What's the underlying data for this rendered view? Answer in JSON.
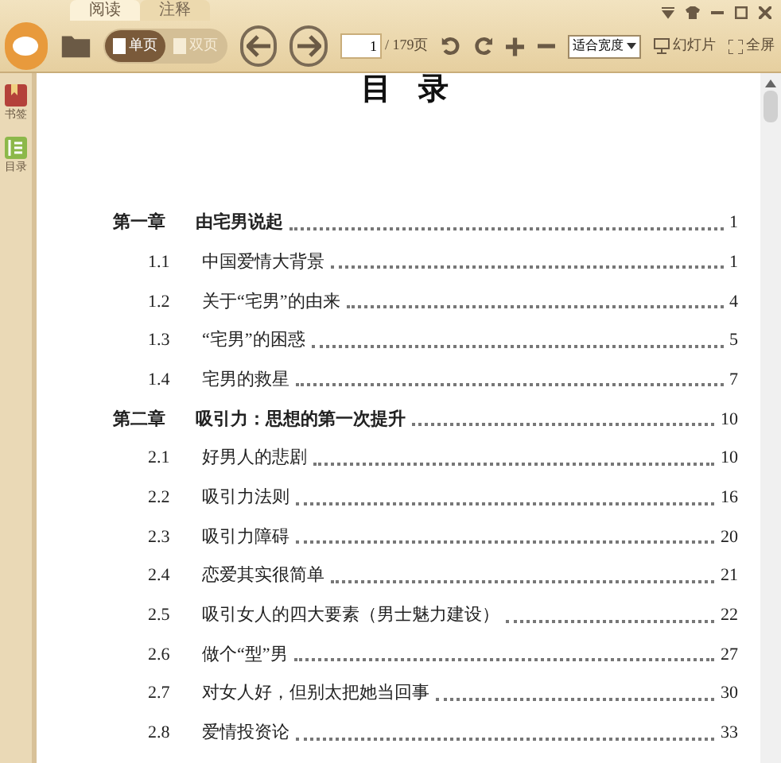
{
  "tabs": [
    {
      "label": "阅读",
      "selected": true
    },
    {
      "label": "注释",
      "selected": false
    }
  ],
  "toolbar": {
    "view_modes": [
      {
        "label": "单页",
        "selected": true
      },
      {
        "label": "双页",
        "selected": false
      }
    ],
    "page_input": "1",
    "page_total": "/ 179页",
    "zoom_select": "适合宽度",
    "slideshow": "幻灯片",
    "fullscreen": "全屏"
  },
  "sidebar": {
    "items": [
      {
        "label": "书签",
        "kind": "bookmark"
      },
      {
        "label": "目录",
        "kind": "toc"
      }
    ]
  },
  "toc": {
    "title": "目 录",
    "entries": [
      {
        "kind": "chapter",
        "number": "第一章",
        "title": "由宅男说起",
        "page": "1"
      },
      {
        "kind": "section",
        "number": "1.1",
        "title": "中国爱情大背景",
        "page": "1"
      },
      {
        "kind": "section",
        "number": "1.2",
        "title": "关于“宅男”的由来",
        "page": "4"
      },
      {
        "kind": "section",
        "number": "1.3",
        "title": "“宅男”的困惑",
        "page": "5"
      },
      {
        "kind": "section",
        "number": "1.4",
        "title": "宅男的救星",
        "page": "7"
      },
      {
        "kind": "chapter",
        "number": "第二章",
        "title": "吸引力：思想的第一次提升",
        "page": "10"
      },
      {
        "kind": "section",
        "number": "2.1",
        "title": "好男人的悲剧",
        "page": "10"
      },
      {
        "kind": "section",
        "number": "2.2",
        "title": "吸引力法则",
        "page": "16"
      },
      {
        "kind": "section",
        "number": "2.3",
        "title": "吸引力障碍",
        "page": "20"
      },
      {
        "kind": "section",
        "number": "2.4",
        "title": "恋爱其实很简单",
        "page": "21"
      },
      {
        "kind": "section",
        "number": "2.5",
        "title": "吸引女人的四大要素（男士魅力建设）",
        "page": "22"
      },
      {
        "kind": "section",
        "number": "2.6",
        "title": "做个“型”男",
        "page": "27"
      },
      {
        "kind": "section",
        "number": "2.7",
        "title": "对女人好，但别太把她当回事",
        "page": "30"
      },
      {
        "kind": "section",
        "number": "2.8",
        "title": "爱情投资论",
        "page": "33"
      }
    ]
  }
}
